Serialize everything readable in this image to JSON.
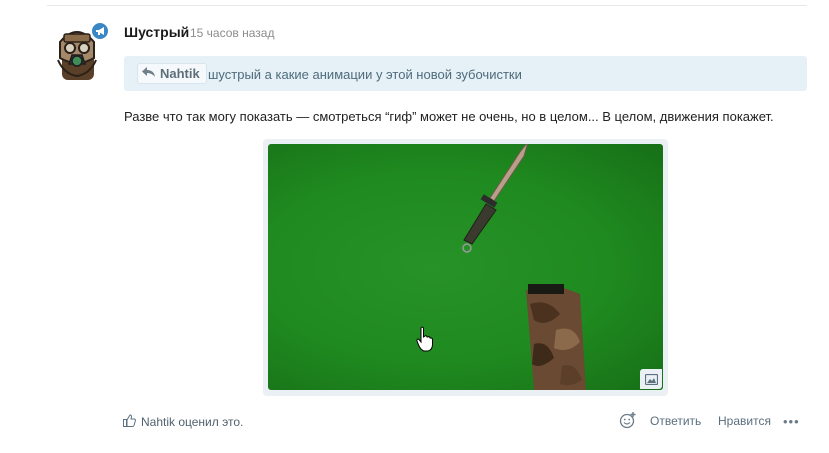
{
  "post": {
    "author": "Шустрый",
    "time": "15 часов назад",
    "quote": {
      "user": "Nahtik",
      "text": "шустрый а какие анимации у этой новой зубочистки"
    },
    "message": "Разве что так могу показать — смотреться “гиф” может не очень, но в целом... В целом, движения покажет.",
    "media": {
      "background_color": "#229022",
      "icon": "image-icon"
    }
  },
  "footer": {
    "liked_by": "Nahtik оценил это.",
    "actions": {
      "reaction_icon": "emoji-add-icon",
      "reply": "Ответить",
      "like": "Нравится",
      "more": "•••"
    }
  }
}
